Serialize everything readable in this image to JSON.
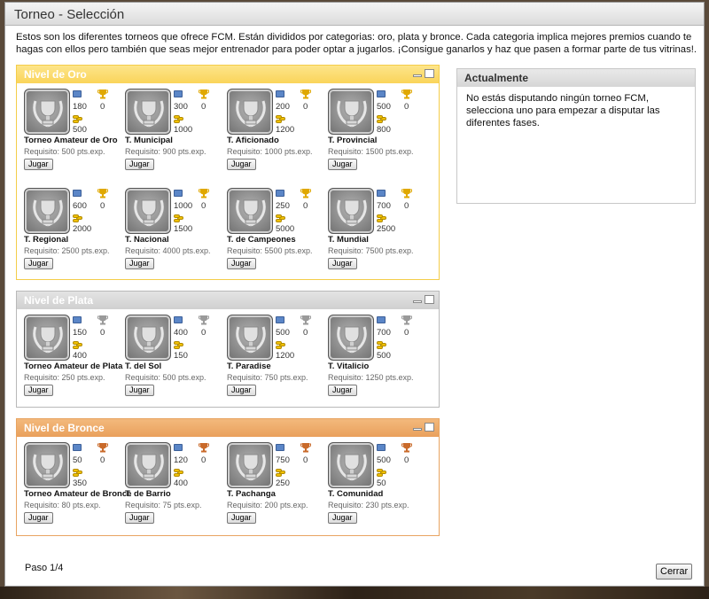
{
  "window": {
    "title": "Torneo - Selección"
  },
  "intro": "Estos son los diferentes torneos que ofrece FCM. Están divididos por categorias: oro, plata y bronce. Cada categoria implica mejores premios cuando te hagas con ellos pero también que seas mejor entrenador para poder optar a jugarlos. ¡Consigue ganarlos y haz que pasen a formar parte de tus vitrinas!.",
  "colors": {
    "gold": "#fad45a",
    "silver": "#d0d0d0",
    "bronze": "#e9a05c",
    "cup_gold": "#e0a800",
    "cup_silver": "#9a9a9a",
    "cup_bronze": "#c96a2a"
  },
  "levels": [
    {
      "title": "Nivel de Oro",
      "tournaments": [
        {
          "name": "Torneo Amateur de Oro",
          "points": "180",
          "trophies": "0",
          "cost": "500",
          "requirement": "Requisito: 500 pts.exp.",
          "button": "Jugar"
        },
        {
          "name": "T. Municipal",
          "points": "300",
          "trophies": "0",
          "cost": "1000",
          "requirement": "Requisito: 900 pts.exp.",
          "button": "Jugar"
        },
        {
          "name": "T. Aficionado",
          "points": "200",
          "trophies": "0",
          "cost": "1200",
          "requirement": "Requisito: 1000 pts.exp.",
          "button": "Jugar"
        },
        {
          "name": "T. Provincial",
          "points": "500",
          "trophies": "0",
          "cost": "800",
          "requirement": "Requisito: 1500 pts.exp.",
          "button": "Jugar"
        },
        {
          "name": "T. Regional",
          "points": "600",
          "trophies": "0",
          "cost": "2000",
          "requirement": "Requisito: 2500 pts.exp.",
          "button": "Jugar"
        },
        {
          "name": "T. Nacional",
          "points": "1000",
          "trophies": "0",
          "cost": "1500",
          "requirement": "Requisito: 4000 pts.exp.",
          "button": "Jugar"
        },
        {
          "name": "T. de Campeones",
          "points": "250",
          "trophies": "0",
          "cost": "5000",
          "requirement": "Requisito: 5500 pts.exp.",
          "button": "Jugar"
        },
        {
          "name": "T. Mundial",
          "points": "700",
          "trophies": "0",
          "cost": "2500",
          "requirement": "Requisito: 7500 pts.exp.",
          "button": "Jugar"
        }
      ]
    },
    {
      "title": "Nivel de Plata",
      "tournaments": [
        {
          "name": "Torneo Amateur de Plata",
          "points": "150",
          "trophies": "0",
          "cost": "400",
          "requirement": "Requisito: 250 pts.exp.",
          "button": "Jugar"
        },
        {
          "name": "T. del Sol",
          "points": "400",
          "trophies": "0",
          "cost": "150",
          "requirement": "Requisito: 500 pts.exp.",
          "button": "Jugar"
        },
        {
          "name": "T. Paradise",
          "points": "500",
          "trophies": "0",
          "cost": "1200",
          "requirement": "Requisito: 750 pts.exp.",
          "button": "Jugar"
        },
        {
          "name": "T. Vitalicio",
          "points": "700",
          "trophies": "0",
          "cost": "500",
          "requirement": "Requisito: 1250 pts.exp.",
          "button": "Jugar"
        }
      ]
    },
    {
      "title": "Nivel de Bronce",
      "tournaments": [
        {
          "name": "Torneo Amateur de Bronce",
          "points": "50",
          "trophies": "0",
          "cost": "350",
          "requirement": "Requisito: 80 pts.exp.",
          "button": "Jugar"
        },
        {
          "name": "T. de Barrio",
          "points": "120",
          "trophies": "0",
          "cost": "400",
          "requirement": "Requisito: 75 pts.exp.",
          "button": "Jugar"
        },
        {
          "name": "T. Pachanga",
          "points": "750",
          "trophies": "0",
          "cost": "250",
          "requirement": "Requisito: 200 pts.exp.",
          "button": "Jugar"
        },
        {
          "name": "T. Comunidad",
          "points": "500",
          "trophies": "0",
          "cost": "50",
          "requirement": "Requisito: 230 pts.exp.",
          "button": "Jugar"
        }
      ]
    }
  ],
  "current": {
    "title": "Actualmente",
    "text": "No estás disputando ningún torneo FCM, selecciona uno para empezar a disputar las diferentes fases."
  },
  "footer": {
    "step": "Paso 1/4",
    "close_label": "Cerrar"
  }
}
